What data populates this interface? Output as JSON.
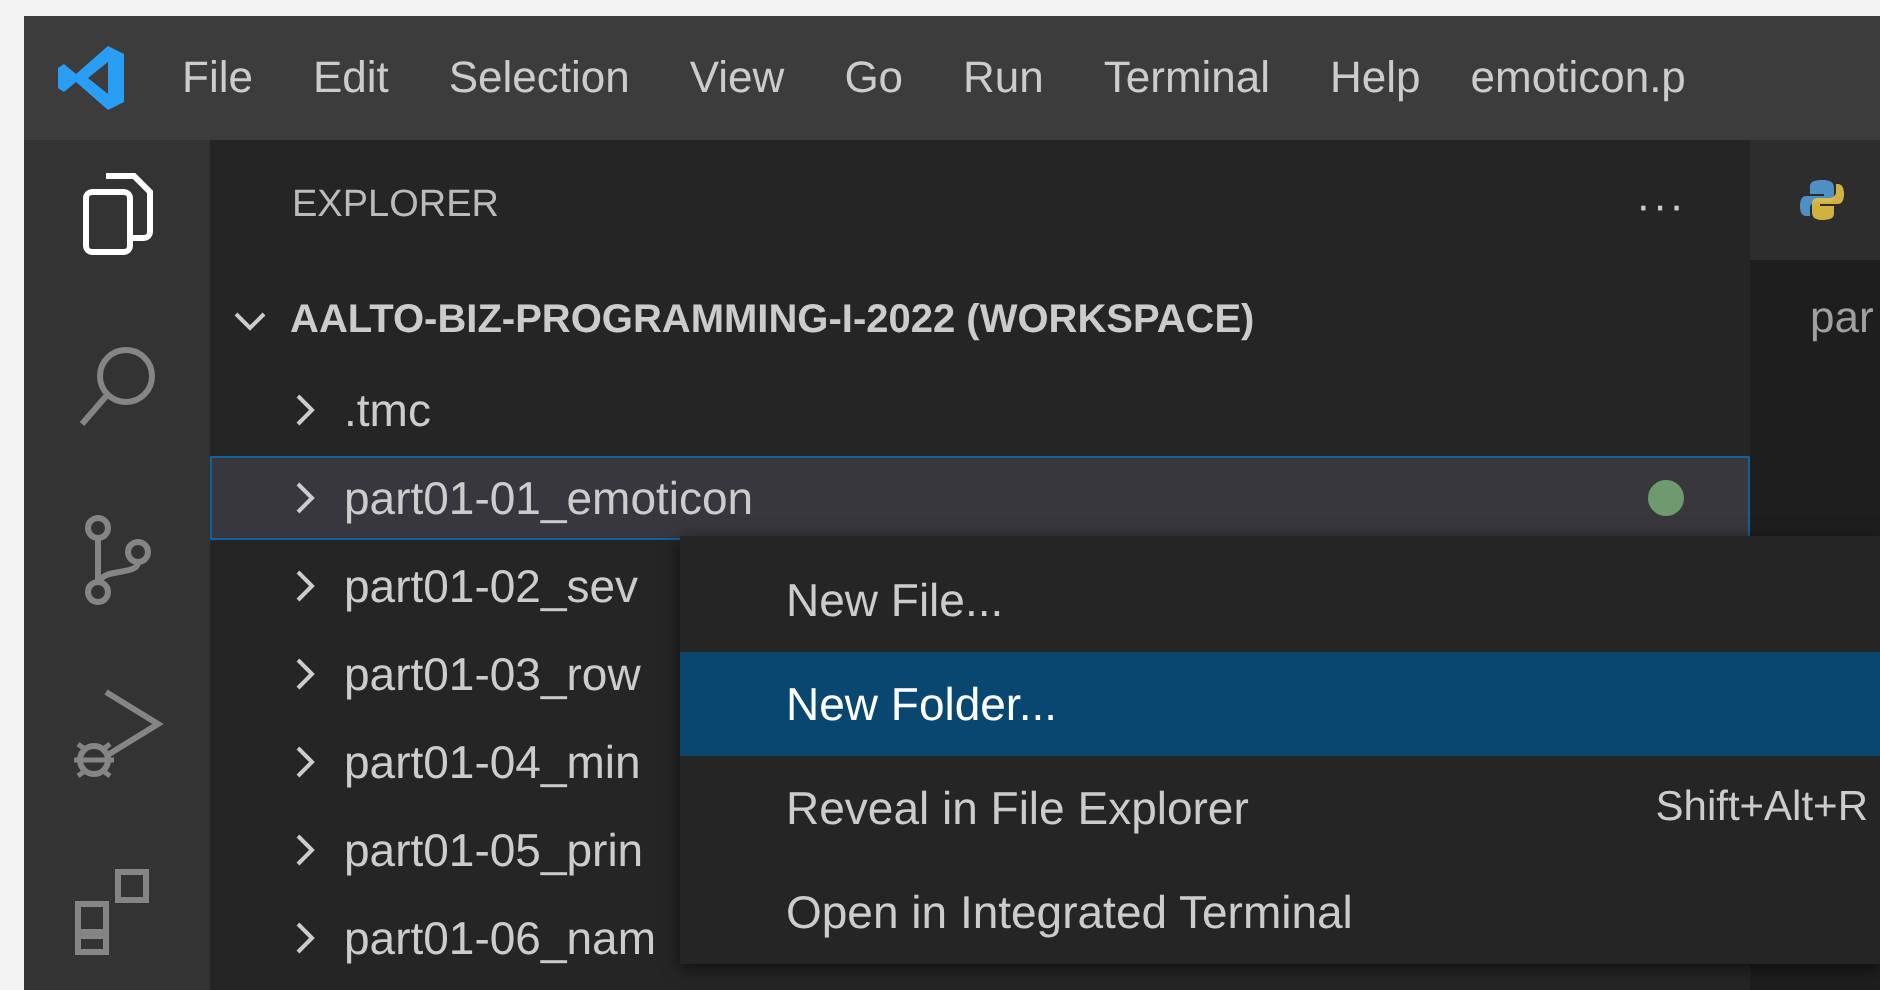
{
  "menu_bar": {
    "items": [
      "File",
      "Edit",
      "Selection",
      "View",
      "Go",
      "Run",
      "Terminal",
      "Help"
    ],
    "title": "emoticon.p"
  },
  "activity_bar": {
    "items": [
      {
        "kind": "files",
        "selected": true
      },
      {
        "kind": "search",
        "selected": false
      },
      {
        "kind": "source-control",
        "selected": false
      },
      {
        "kind": "run-debug",
        "selected": false
      },
      {
        "kind": "extensions",
        "selected": false
      }
    ]
  },
  "sidebar": {
    "title": "EXPLORER",
    "more": "···",
    "workspace": {
      "label": "AALTO-BIZ-PROGRAMMING-I-2022 (WORKSPACE)",
      "expanded": true,
      "children": [
        {
          "label": ".tmc",
          "selected": false,
          "expanded": false
        },
        {
          "label": "part01-01_emoticon",
          "selected": true,
          "expanded": false,
          "color": "#6f9a6f"
        },
        {
          "label": "part01-02_sev",
          "selected": false,
          "expanded": false
        },
        {
          "label": "part01-03_row",
          "selected": false,
          "expanded": false
        },
        {
          "label": "part01-04_min",
          "selected": false,
          "expanded": false
        },
        {
          "label": "part01-05_prin",
          "selected": false,
          "expanded": false
        },
        {
          "label": "part01-06_nam",
          "selected": false,
          "expanded": false
        }
      ]
    }
  },
  "editor": {
    "breadcrumb": "par"
  },
  "context_menu": {
    "items": [
      {
        "label": "New File...",
        "selected": false
      },
      {
        "label": "New Folder...",
        "selected": true
      },
      {
        "label": "Reveal in File Explorer",
        "shortcut": "Shift+Alt+R",
        "selected": false
      },
      {
        "label": "Open in Integrated Terminal",
        "selected": false
      }
    ]
  }
}
